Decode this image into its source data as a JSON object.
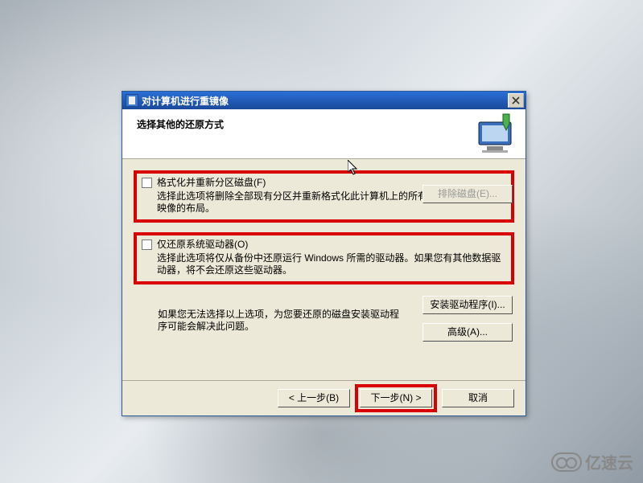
{
  "window": {
    "title": "对计算机进行重镜像"
  },
  "header": {
    "heading": "选择其他的还原方式"
  },
  "options": {
    "format": {
      "label": "格式化并重新分区磁盘(F)",
      "description": "选择此选项将删除全部现有分区并重新格式化此计算机上的所有磁盘，以匹配系统映像的布局。"
    },
    "only_system": {
      "label": "仅还原系统驱动器(O)",
      "description": "选择此选项将仅从备份中还原运行 Windows 所需的驱动器。如果您有其他数据驱动器，将不会还原这些驱动器。"
    }
  },
  "buttons": {
    "exclude_disk": "排除磁盘(E)...",
    "install_driver": "安装驱动程序(I)...",
    "advanced": "高级(A)...",
    "back": "< 上一步(B)",
    "next": "下一步(N) >",
    "cancel": "取消"
  },
  "info": {
    "text": "如果您无法选择以上选项，为您要还原的磁盘安装驱动程序可能会解决此问题。"
  },
  "watermark": {
    "text": "亿速云"
  }
}
